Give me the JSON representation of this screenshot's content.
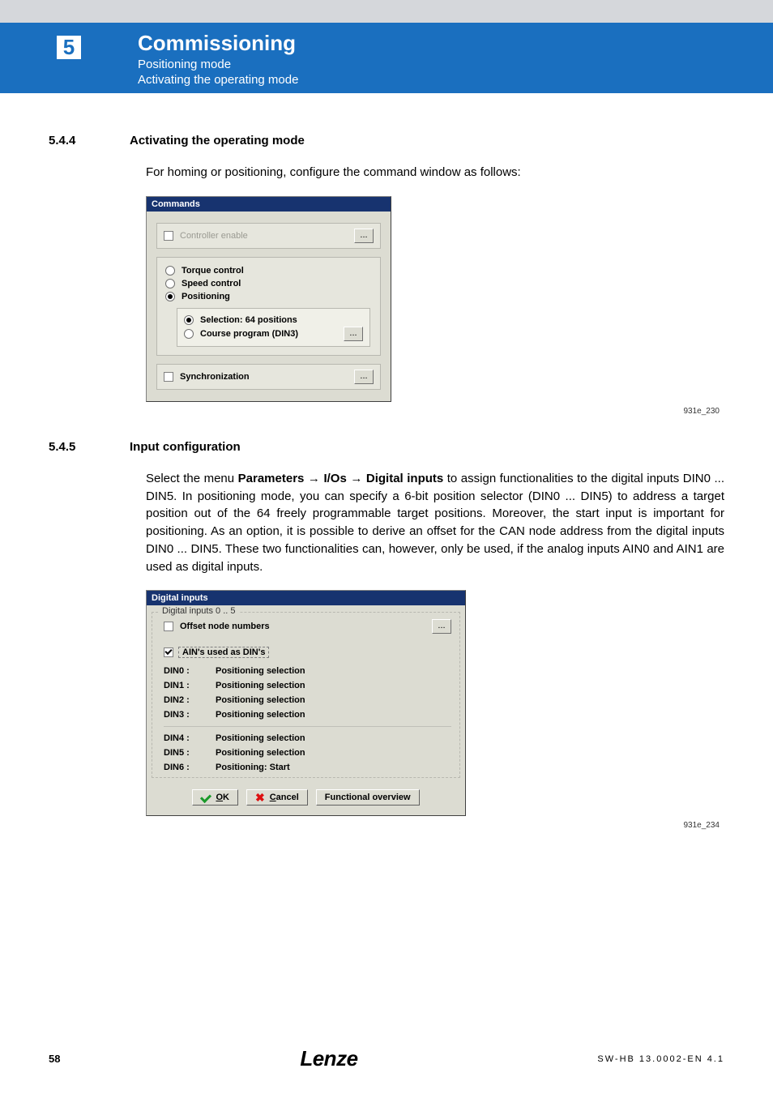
{
  "header": {
    "chapter_num": "5",
    "chapter_title": "Commissioning",
    "sub1": "Positioning mode",
    "sub2": "Activating the operating mode"
  },
  "sec1": {
    "num": "5.4.4",
    "title": "Activating the operating mode",
    "lead": "For homing or positioning, configure the command window as follows:"
  },
  "cmd": {
    "title": "Commands",
    "controller_enable": "Controller enable",
    "torque": "Torque control",
    "speed": "Speed control",
    "positioning": "Positioning",
    "sel64": "Selection: 64 positions",
    "course": "Course program (DIN3)",
    "sync": "Synchronization",
    "dots": "...",
    "fig_id": "931e_230"
  },
  "sec2": {
    "num": "5.4.5",
    "title": "Input configuration",
    "body_pre": "Select the menu ",
    "menu_param": "Parameters",
    "menu_ios": "I/Os",
    "menu_di": "Digital inputs",
    "body_rest": " to assign functionalities to the digital inputs DIN0 ... DIN5. In positioning mode, you can specify a 6-bit position selector (DIN0 ... DIN5) to address a target position out of the 64 freely programmable target positions. Moreover, the start input is important for positioning. As an option, it is possible to derive an offset for the CAN node address from the digital inputs DIN0 ... DIN5. These two functionalities can, however, only be used, if the analog inputs AIN0 and AIN1 are used as digital inputs."
  },
  "di": {
    "title": "Digital inputs",
    "group_label": "Digital inputs  0 .. 5",
    "offset": "Offset node numbers",
    "ain": "AIN's used as DIN's",
    "rows1": [
      {
        "k": "DIN0 :",
        "v": "Positioning selection"
      },
      {
        "k": "DIN1 :",
        "v": "Positioning selection"
      },
      {
        "k": "DIN2 :",
        "v": "Positioning selection"
      },
      {
        "k": "DIN3 :",
        "v": "Positioning selection"
      }
    ],
    "rows2": [
      {
        "k": "DIN4 :",
        "v": "Positioning selection"
      },
      {
        "k": "DIN5 :",
        "v": "Positioning selection"
      },
      {
        "k": "DIN6 :",
        "v": "Positioning: Start"
      }
    ],
    "ok_u": "O",
    "ok_rest": "K",
    "cancel_u": "C",
    "cancel_rest": "ancel",
    "func_over": "Functional overview",
    "dots": "...",
    "fig_id": "931e_234"
  },
  "footer": {
    "page": "58",
    "logo": "Lenze",
    "docid": "SW-HB 13.0002-EN   4.1"
  }
}
